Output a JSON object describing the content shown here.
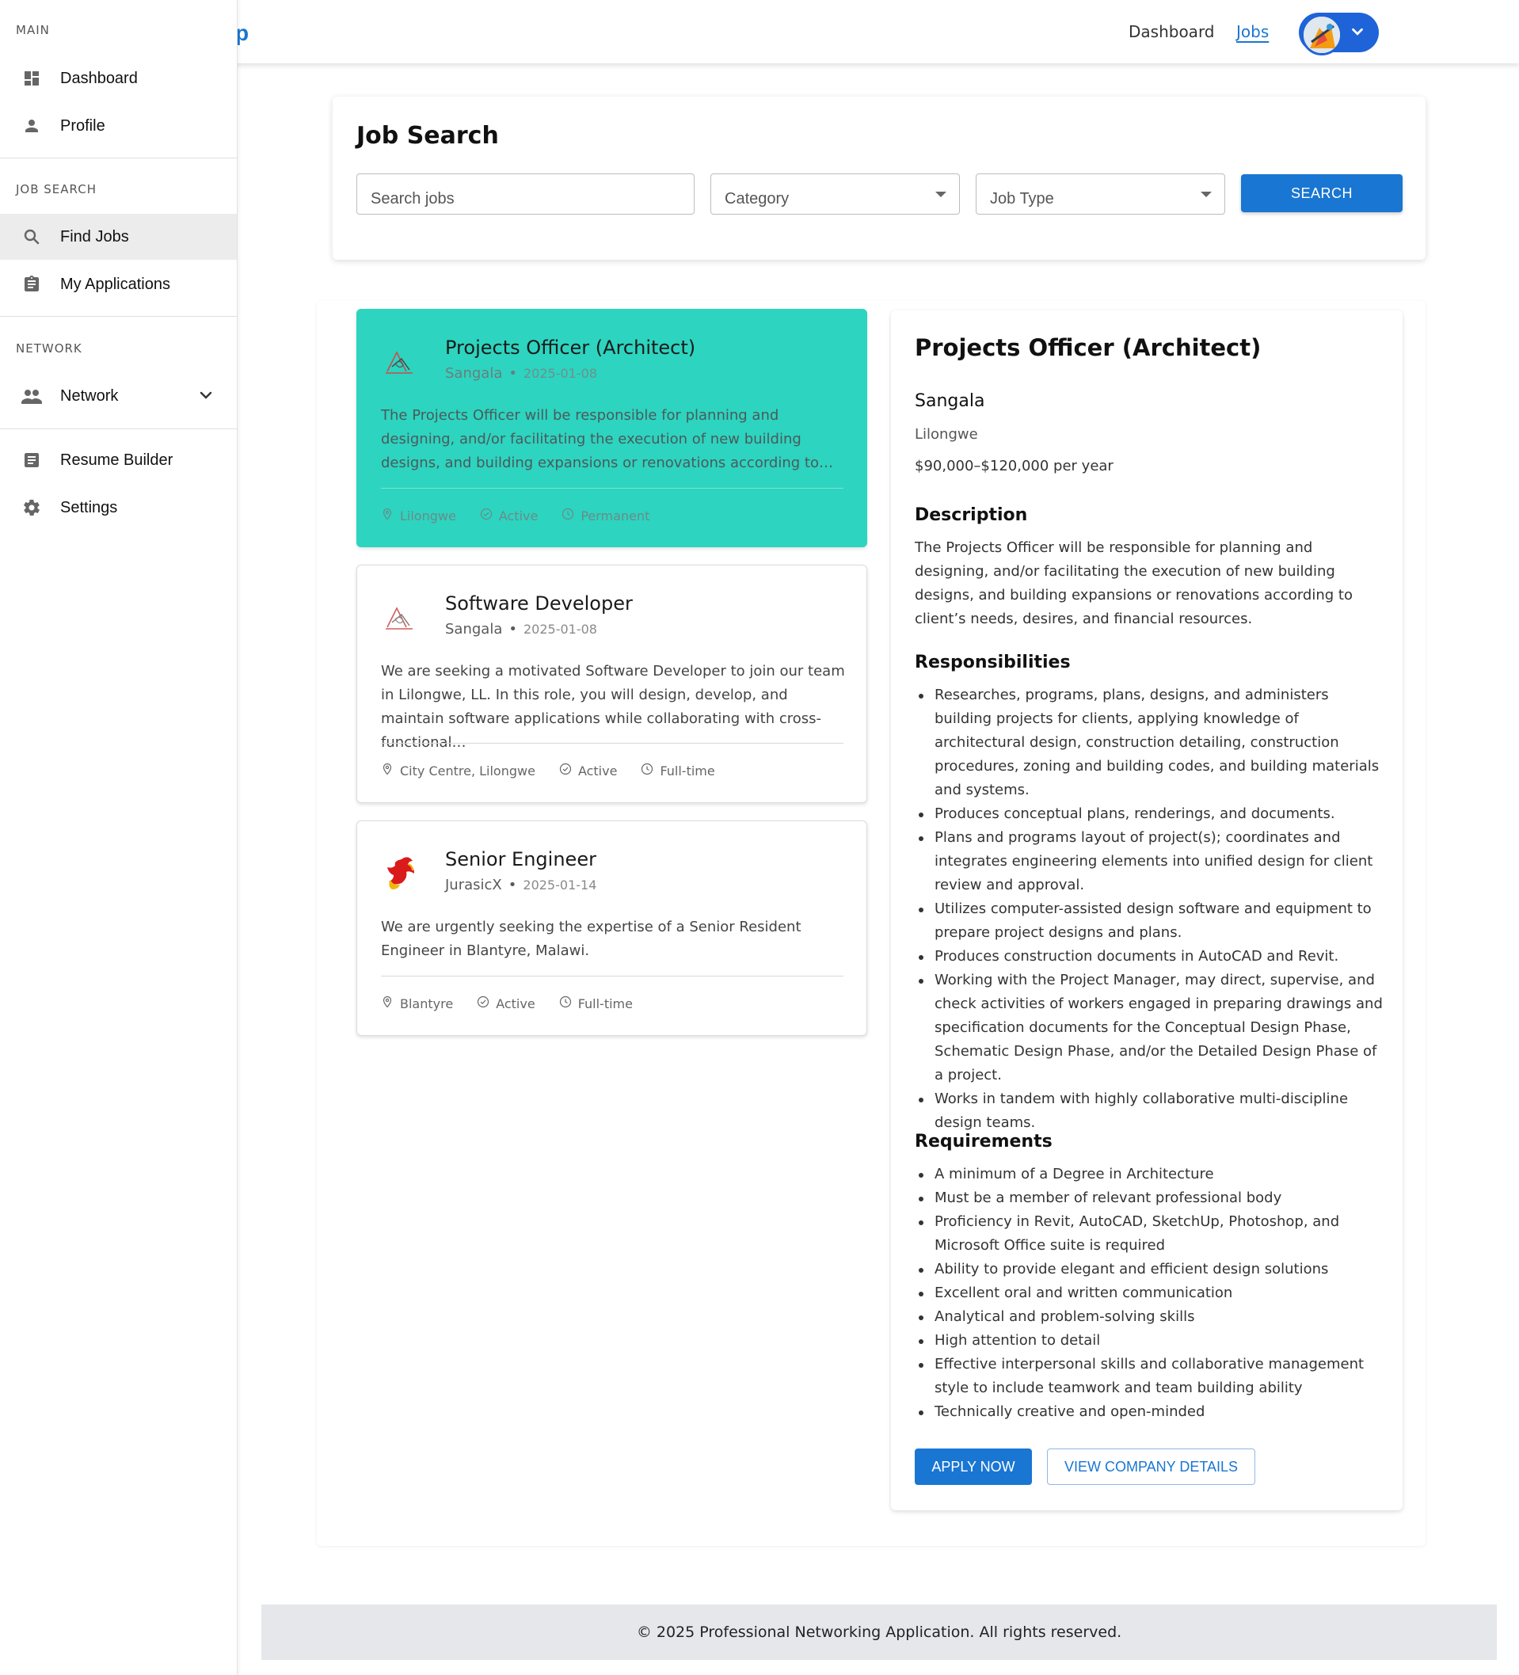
{
  "topbar": {
    "brand_fragment": "p",
    "nav": {
      "dashboard": "Dashboard",
      "jobs": "Jobs"
    },
    "avatar_icon": "user-avatar",
    "menu_icon": "chevron-down-icon"
  },
  "sidebar": {
    "sections": {
      "main": "MAIN",
      "job_search": "JOB SEARCH",
      "network": "NETWORK"
    },
    "items": {
      "dashboard": "Dashboard",
      "profile": "Profile",
      "find_jobs": "Find Jobs",
      "my_applications": "My Applications",
      "network": "Network",
      "resume_builder": "Resume Builder",
      "settings": "Settings"
    }
  },
  "search": {
    "title": "Job Search",
    "keywords_placeholder": "Search jobs",
    "category_placeholder": "Category",
    "job_type_placeholder": "Job Type",
    "button": "SEARCH"
  },
  "jobs": [
    {
      "title": "Projects Officer (Architect)",
      "company": "Sangala",
      "date": "2025-01-08",
      "description": "The Projects Officer will be responsible for planning and designing, and/or facilitating the execution of new building designs, and building expansions or renovations according to…",
      "location": "Lilongwe",
      "status": "Active",
      "type": "Permanent"
    },
    {
      "title": "Software Developer",
      "company": "Sangala",
      "date": "2025-01-08",
      "description": "We are seeking a motivated Software Developer to join our team in Lilongwe, LL. In this role, you will design, develop, and maintain software applications while collaborating with cross-functional…",
      "location": "City Centre, Lilongwe",
      "status": "Active",
      "type": "Full-time"
    },
    {
      "title": "Senior Engineer",
      "company": "JurasicX",
      "date": "2025-01-14",
      "description": "We are urgently seeking the expertise of a Senior Resident Engineer in Blantyre, Malawi.",
      "location": "Blantyre",
      "status": "Active",
      "type": "Full-time"
    }
  ],
  "detail": {
    "title": "Projects Officer (Architect)",
    "company": "Sangala",
    "location": "Lilongwe",
    "salary": "$90,000–$120,000 per year",
    "description_heading": "Description",
    "description": "The Projects Officer will be responsible for planning and designing, and/or facilitating the execution of new building designs, and building expansions or renovations according to client’s needs, desires, and financial resources.",
    "responsibilities_heading": "Responsibilities",
    "responsibilities": [
      "Researches, programs, plans, designs, and administers building projects for clients, applying knowledge of architectural design, construction detailing, construction procedures, zoning and building codes, and building materials and systems.",
      "Produces conceptual plans, renderings, and documents.",
      "Plans and programs layout of project(s); coordinates and integrates engineering elements into unified design for client review and approval.",
      "Utilizes computer-assisted design software and equipment to prepare project designs and plans.",
      "Produces construction documents in AutoCAD and Revit.",
      "Working with the Project Manager, may direct, supervise, and check activities of workers engaged in preparing drawings and specification documents for the Conceptual Design Phase, Schematic Design Phase, and/or the Detailed Design Phase of a project.",
      "Works in tandem with highly collaborative multi-discipline design teams."
    ],
    "requirements_heading": "Requirements",
    "requirements": [
      "A minimum of a Degree in Architecture",
      "Must be a member of relevant professional body",
      "Proficiency in Revit, AutoCAD, SketchUp, Photoshop, and Microsoft Office suite is required",
      "Ability to provide elegant and efficient design solutions",
      "Excellent oral and written communication",
      "Analytical and problem-solving skills",
      "High attention to detail",
      "Effective interpersonal skills and collaborative management style to include teamwork and team building ability",
      "Technically creative and open-minded"
    ],
    "apply_button": "APPLY NOW",
    "company_button": "VIEW COMPANY DETAILS"
  },
  "footer": {
    "text": "© 2025 Professional Networking Application. All rights reserved."
  },
  "colors": {
    "accent": "#1976d2",
    "selected_card": "#2dd4bf",
    "footer_bg": "#e5e7eb"
  }
}
